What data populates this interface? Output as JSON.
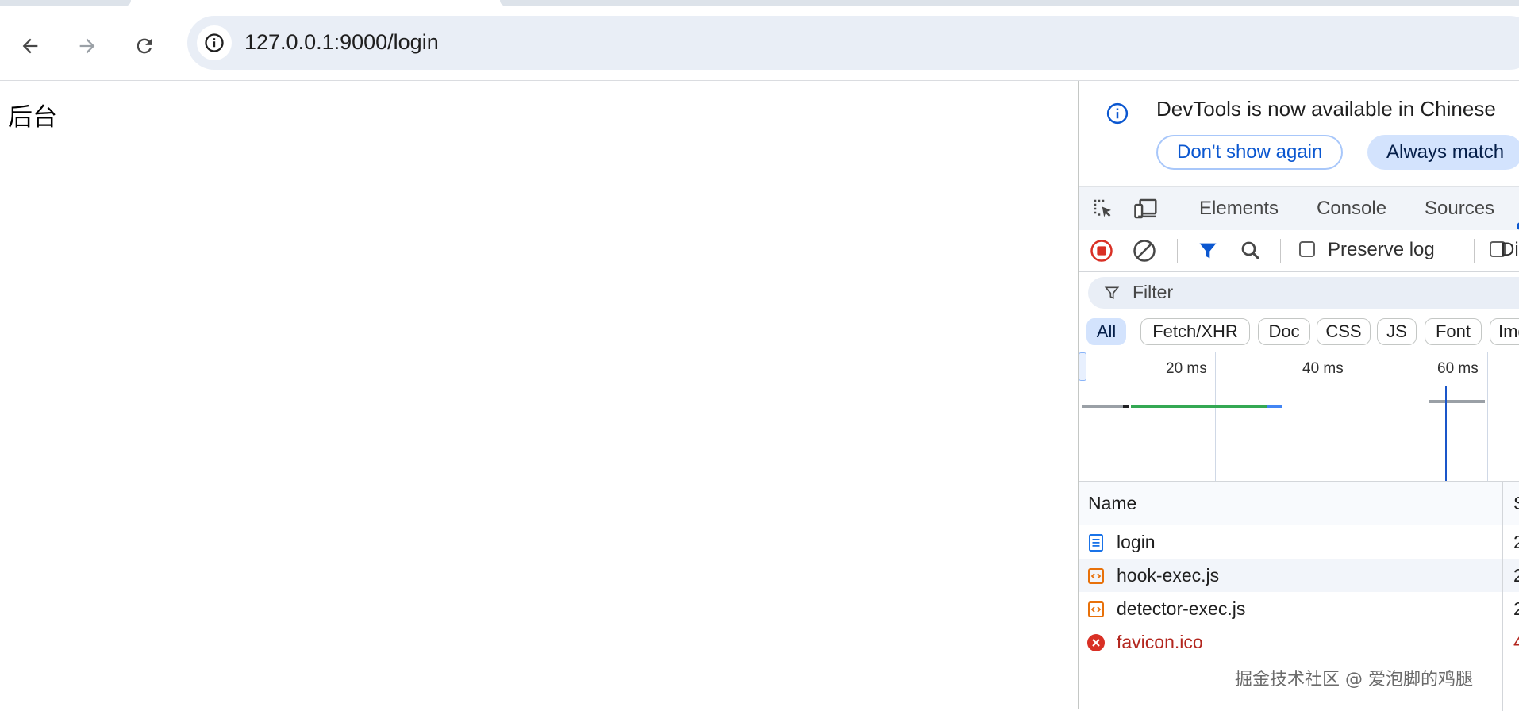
{
  "browser": {
    "url": "127.0.0.1:9000/login"
  },
  "page": {
    "heading": "后台"
  },
  "devtools": {
    "infobar": {
      "message": "DevTools is now available in Chinese",
      "dont_show_label": "Don't show again",
      "always_match_label": "Always match"
    },
    "tabs": [
      "Elements",
      "Console",
      "Sources"
    ],
    "network_toolbar": {
      "preserve_log_label": "Preserve log",
      "disable_cache_label": "Di"
    },
    "filter": {
      "placeholder": "Filter"
    },
    "type_filters": [
      "All",
      "Fetch/XHR",
      "Doc",
      "CSS",
      "JS",
      "Font",
      "Img"
    ],
    "overview": {
      "ticks": [
        "20 ms",
        "40 ms",
        "60 ms"
      ]
    },
    "requests": {
      "columns": {
        "name": "Name",
        "status": "S"
      },
      "rows": [
        {
          "name": "login",
          "status": "2",
          "icon": "document-icon",
          "error": false
        },
        {
          "name": "hook-exec.js",
          "status": "2",
          "icon": "script-icon",
          "error": false
        },
        {
          "name": "detector-exec.js",
          "status": "2",
          "icon": "script-icon",
          "error": false
        },
        {
          "name": "favicon.ico",
          "status": "4",
          "icon": "error-icon",
          "error": true
        }
      ]
    }
  },
  "watermark": "掘金技术社区 @ 爱泡脚的鸡腿",
  "colors": {
    "accent": "#0b57d0",
    "record": "#d93025",
    "error": "#b3261e",
    "waiting": "#34a853",
    "download": "#4285f4"
  }
}
